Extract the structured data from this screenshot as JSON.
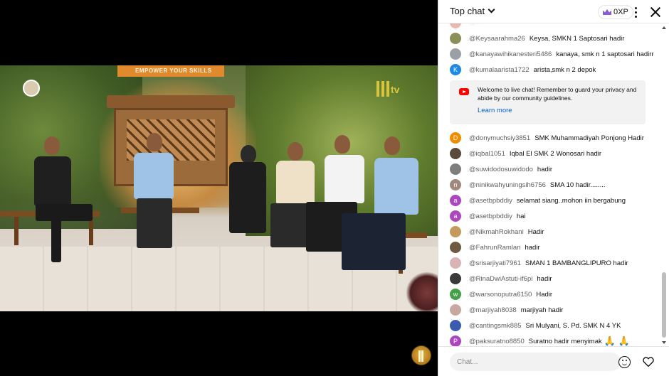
{
  "chat": {
    "mode_label": "Top chat",
    "xp_label": "0XP",
    "welcome": {
      "text": "Welcome to live chat! Remember to guard your privacy and abide by our community guidelines.",
      "link": "Learn more"
    },
    "input_placeholder": "Chat...",
    "messages_before": [
      {
        "author": "@Keysaarahma26",
        "text": "Keysa, SMKN 1 Saptosari hadir",
        "avatar_color": "#8a8f5a",
        "initial": ""
      },
      {
        "author": "@kanayawihikanesteri5486",
        "text": "kanaya, smk n 1 saptosari hadirr",
        "avatar_color": "#9aa0a6",
        "initial": ""
      },
      {
        "author": "@kumalaarista1722",
        "text": "arista,smk n 2 depok",
        "avatar_color": "#1e88e5",
        "initial": "K"
      }
    ],
    "messages_after": [
      {
        "author": "@donymuchsiy3851",
        "text": "SMK Muhammadiyah Ponjong Hadir",
        "avatar_color": "#ef8c00",
        "initial": "D"
      },
      {
        "author": "@iqbal1051",
        "text": "Iqbal El SMK 2 Wonosari hadir",
        "avatar_color": "#5b4a3a",
        "initial": ""
      },
      {
        "author": "@suwidodosuwidodo",
        "text": "hadir",
        "avatar_color": "#7d7d7d",
        "initial": ""
      },
      {
        "author": "@ninikwahyuningsih6756",
        "text": "SMA 10 hadir........",
        "avatar_color": "#a1887f",
        "initial": "n"
      },
      {
        "author": "@asetbpbddiy",
        "text": "selamat siang..mohon iin bergabung",
        "avatar_color": "#ab47bc",
        "initial": "a"
      },
      {
        "author": "@asetbpbddiy",
        "text": "hai",
        "avatar_color": "#ab47bc",
        "initial": "a"
      },
      {
        "author": "@NikmahRokhani",
        "text": "Hadir",
        "avatar_color": "#c49a5a",
        "initial": ""
      },
      {
        "author": "@FahrunRamlan",
        "text": "hadir",
        "avatar_color": "#6d5a40",
        "initial": ""
      },
      {
        "author": "@srisarjiyati7961",
        "text": "SMAN 1 BAMBANGLIPURO hadir",
        "avatar_color": "#d8b4b4",
        "initial": ""
      },
      {
        "author": "@RinaDwiAstuti-if6pi",
        "text": "hadir",
        "avatar_color": "#3a3a3a",
        "initial": ""
      },
      {
        "author": "@warsonoputra6150",
        "text": "Hadir",
        "avatar_color": "#43a047",
        "initial": "w"
      },
      {
        "author": "@marjiyah8038",
        "text": "marjiyah hadir",
        "avatar_color": "#c8a8a0",
        "initial": ""
      },
      {
        "author": "@cantingsmk885",
        "text": "Sri Mulyani, S. Pd. SMK N 4 YK",
        "avatar_color": "#3b5bb0",
        "initial": ""
      },
      {
        "author": "@paksuratno8850",
        "text": "Suratno hadir menyimak",
        "avatar_color": "#ab47bc",
        "initial": "P",
        "emoji": "🙏 🙏"
      }
    ]
  },
  "video": {
    "banner_text": "EMPOWER YOUR SKILLS",
    "logo_text": "tv"
  },
  "colors": {
    "accent_link": "#065fd4",
    "youtube_red": "#ff0000",
    "crown_purple": "#8a5cd6"
  }
}
